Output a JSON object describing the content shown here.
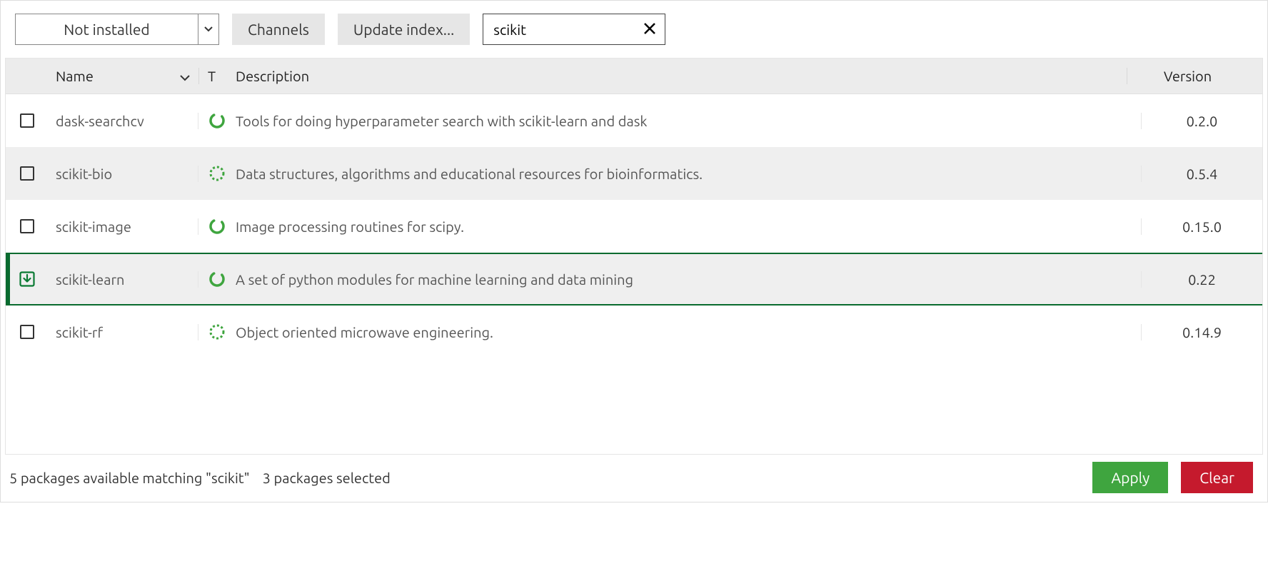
{
  "toolbar": {
    "filter_label": "Not installed",
    "channels_label": "Channels",
    "update_index_label": "Update index...",
    "search_value": "scikit"
  },
  "table": {
    "headers": {
      "name": "Name",
      "t": "T",
      "description": "Description",
      "version": "Version"
    },
    "rows": [
      {
        "name": "dask-searchcv",
        "description": "Tools for doing hyperparameter search with scikit-learn and dask",
        "version": "0.2.0",
        "spinner": "solid",
        "selected": false
      },
      {
        "name": "scikit-bio",
        "description": "Data structures, algorithms and educational resources for bioinformatics.",
        "version": "0.5.4",
        "spinner": "dashed",
        "selected": false
      },
      {
        "name": "scikit-image",
        "description": "Image processing routines for scipy.",
        "version": "0.15.0",
        "spinner": "solid",
        "selected": false
      },
      {
        "name": "scikit-learn",
        "description": "A set of python modules for machine learning and data mining",
        "version": "0.22",
        "spinner": "solid",
        "selected": true
      },
      {
        "name": "scikit-rf",
        "description": "Object oriented microwave engineering.",
        "version": "0.14.9",
        "spinner": "dashed",
        "selected": false
      }
    ]
  },
  "footer": {
    "status_available": "5 packages available matching \"scikit\"",
    "status_selected": "3 packages selected",
    "apply_label": "Apply",
    "clear_label": "Clear"
  }
}
